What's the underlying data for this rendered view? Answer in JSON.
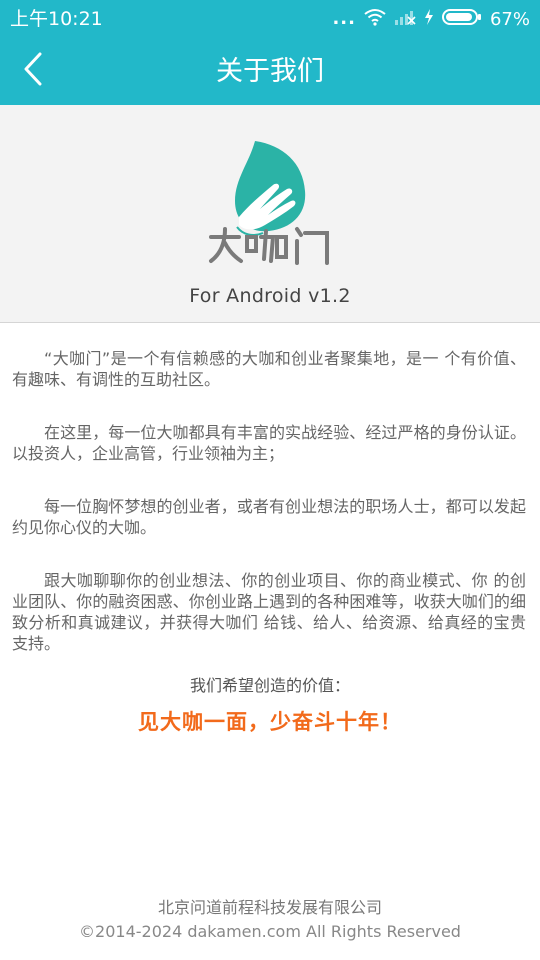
{
  "status_bar": {
    "time": "上午10:21",
    "dots": "...",
    "battery": "67%"
  },
  "nav": {
    "title": "关于我们"
  },
  "hero": {
    "version": "For Android v1.2"
  },
  "about": {
    "paragraphs": [
      "“大咖门”是一个有信赖感的大咖和创业者聚集地，是一 个有价值、有趣味、有调性的互助社区。",
      "在这里，每一位大咖都具有丰富的实战经验、经过严格的身份认证。以投资人，企业高管，行业领袖为主；",
      "每一位胸怀梦想的创业者，或者有创业想法的职场人士，都可以发起约见你心仪的大咖。",
      "跟大咖聊聊你的创业想法、你的创业项目、你的商业模式、你 的创业团队、你的融资困惑、你创业路上遇到的各种困难等，收获大咖们的细致分析和真诚建议，并获得大咖们 给钱、给人、给资源、给真经的宝贵支持。"
    ],
    "value_label": "我们希望创造的价值：",
    "slogan": "见大咖一面，少奋斗十年！"
  },
  "footer": {
    "company": "北京问道前程科技发展有限公司",
    "copyright": "©2014-2024 dakamen.com All Rights Reserved"
  },
  "colors": {
    "header": "#22b8c9",
    "accent": "#f26a1b",
    "logo_leaf": "#2bb3a6"
  },
  "icons": {
    "back": "chevron-left-icon",
    "wifi": "wifi-icon",
    "signal": "signal-icon",
    "charging": "charging-icon",
    "battery": "battery-icon"
  }
}
